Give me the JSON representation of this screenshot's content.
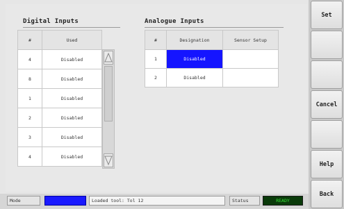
{
  "digital_inputs": {
    "title": "Digital Inputs",
    "headers": [
      "#",
      "Used"
    ],
    "rows": [
      {
        "num": "4",
        "used": "Disabled"
      },
      {
        "num": "8",
        "used": "Disabled"
      },
      {
        "num": "1",
        "used": "Disabled"
      },
      {
        "num": "2",
        "used": "Disabled"
      },
      {
        "num": "3",
        "used": "Disabled"
      },
      {
        "num": "4",
        "used": "Disabled"
      }
    ]
  },
  "analogue_inputs": {
    "title": "Analogue Inputs",
    "headers": [
      "#",
      "Designation",
      "Sensor Setup"
    ],
    "rows": [
      {
        "num": "1",
        "designation": "Disabled",
        "sensor_setup": ""
      },
      {
        "num": "2",
        "designation": "Disabled",
        "sensor_setup": ""
      }
    ]
  },
  "side_buttons": [
    {
      "label": "Set"
    },
    {
      "label": ""
    },
    {
      "label": ""
    },
    {
      "label": "Cancel"
    },
    {
      "label": ""
    },
    {
      "label": "Help"
    },
    {
      "label": "Back"
    }
  ],
  "status_bar": {
    "mode_label": "Mode",
    "mode_value": "",
    "message": "Loaded tool: Tol 12",
    "status_label": "Status",
    "status_value": "READY"
  },
  "colors": {
    "selected_cell": "#1515ff",
    "mode_indicator": "#1a1aff",
    "status_indicator": "#0a3a0a",
    "status_text": "#36e036"
  }
}
